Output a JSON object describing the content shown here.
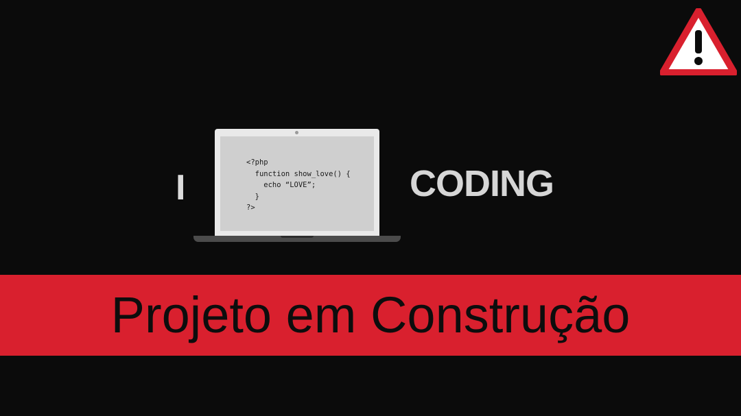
{
  "icons": {
    "warning": "warning-triangle-icon"
  },
  "colors": {
    "background": "#0b0b0b",
    "banner": "#d9202e",
    "warning_red": "#d9202e",
    "text_light": "#d6d6d6"
  },
  "hero": {
    "left_word": "I",
    "right_word": "CODING",
    "code": "<?php\n  function show_love() {\n    echo “LOVE”;\n  }\n?>"
  },
  "banner": {
    "title": "Projeto em Construção"
  }
}
